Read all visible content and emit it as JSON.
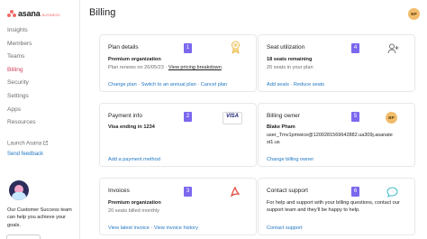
{
  "app": {
    "logo_text": "asana",
    "logo_sub": "BUSINESS"
  },
  "sidebar": {
    "items": [
      {
        "label": "Insights"
      },
      {
        "label": "Members"
      },
      {
        "label": "Teams"
      },
      {
        "label": "Billing",
        "active": true
      },
      {
        "label": "Security"
      },
      {
        "label": "Settings"
      },
      {
        "label": "Apps"
      },
      {
        "label": "Resources"
      }
    ],
    "launch_label": "Launch Asana",
    "feedback_label": "Send feedback",
    "promo_text": "Our Customer Success team can help you achieve your goals."
  },
  "header": {
    "title": "Billing",
    "avatar_initials": "BP"
  },
  "cards": {
    "plan": {
      "number": "1",
      "title": "Plan details",
      "plan_name": "Premium organization",
      "renew_text": "Plan renews on 26/05/23 · ",
      "pricing_link": "View pricing breakdown",
      "actions": [
        "Change plan",
        "Switch to an annual plan",
        "Cancel plan"
      ]
    },
    "payment": {
      "number": "2",
      "title": "Payment info",
      "card_text": "Visa ending in 1234",
      "action": "Add a payment method",
      "visa_label": "VISA"
    },
    "invoices": {
      "number": "3",
      "title": "Invoices",
      "plan_name": "Premium organization",
      "billing": "20 seats billed monthly",
      "actions": [
        "View latest invoice",
        "View invoice history"
      ]
    },
    "seats": {
      "number": "4",
      "title": "Seat utilization",
      "remaining": "18 seats remaining",
      "detail": "20 seats in your plan",
      "actions": [
        "Add seats",
        "Reduce seats"
      ]
    },
    "owner": {
      "number": "5",
      "title": "Billing owner",
      "name": "Blake Pham",
      "email_line1": "user_Tmv1pmwice@1200281569642882.ua309j.asanate",
      "email_line2": "st1.us",
      "avatar_initials": "BP",
      "action": "Change billing owner"
    },
    "support": {
      "number": "6",
      "title": "Contact support",
      "text": "For help and support with your billing questions, contact our support team and they'll be happy to help.",
      "action": "Contact support"
    }
  },
  "colors": {
    "accent": "#7b68ee",
    "link": "#1f76c2",
    "active_nav": "#d1425b",
    "brand": "#f06a6a"
  }
}
